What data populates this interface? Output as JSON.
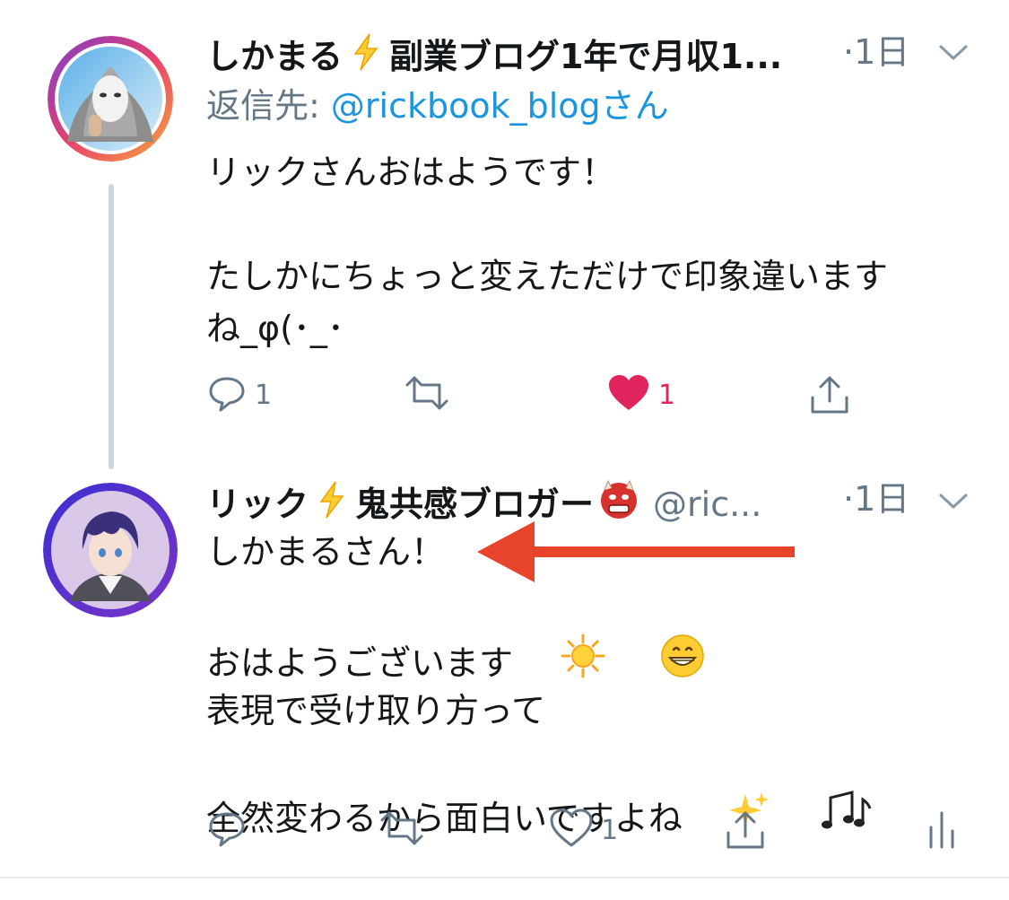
{
  "tweet1": {
    "name": "しかまる",
    "name_rest": "副業ブログ1年で月収1...",
    "time": "·1日",
    "reply_label": "返信先:",
    "reply_mention": "@rickbook_blog",
    "reply_suffix": "さん",
    "text": "リックさんおはようです！\n\nたしかにちょっと変えただけで印象違います\nね_φ(･_･",
    "reply_count": "1",
    "like_count": "1",
    "icons": [
      "reply-icon",
      "retweet-icon",
      "heart-filled-icon",
      "share-icon"
    ]
  },
  "tweet2": {
    "name": "リック",
    "name_rest": "鬼共感ブロガー",
    "handle": "@ric...",
    "time": "·1日",
    "text_line1": "しかまるさん！",
    "text_line2": "おはようございます",
    "text_rest": "表現で受け取り方って",
    "text_last": "全然変わるから面白いですよね",
    "like_count": "1",
    "icons": [
      "reply-icon",
      "retweet-icon",
      "heart-outline-icon",
      "share-icon",
      "analytics-icon"
    ]
  },
  "colors": {
    "accent": "#1b95e0",
    "like": "#e0245e",
    "muted": "#657786",
    "arrow": "#e8432b"
  }
}
